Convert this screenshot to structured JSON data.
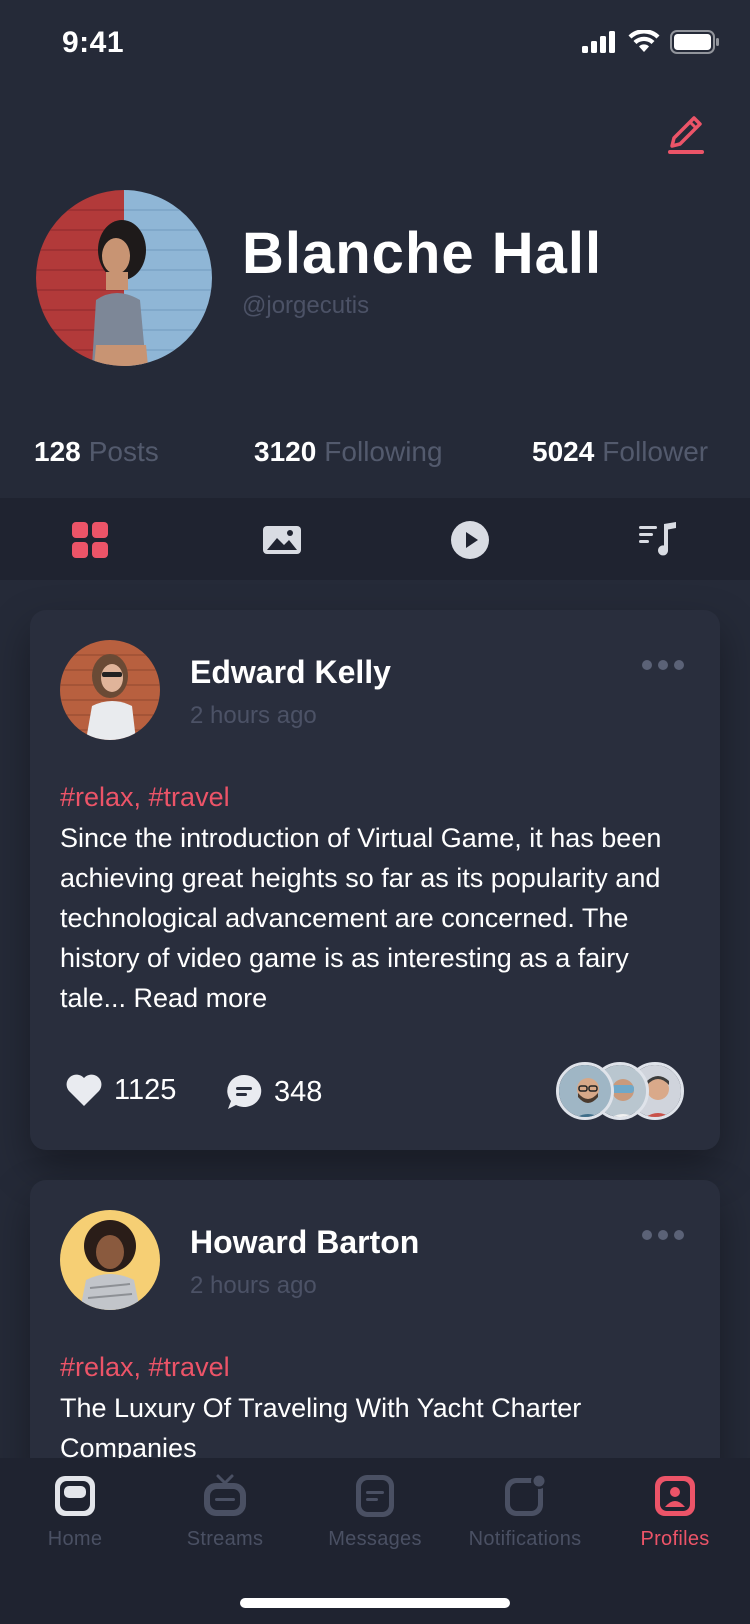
{
  "status": {
    "time": "9:41"
  },
  "profile": {
    "name": "Blanche Hall",
    "handle": "@jorgecutis",
    "stats": [
      {
        "count": "128",
        "label": "Posts"
      },
      {
        "count": "3120",
        "label": "Following"
      },
      {
        "count": "5024",
        "label": "Follower"
      }
    ]
  },
  "content_tabs": [
    {
      "icon": "grid-icon",
      "active": true
    },
    {
      "icon": "image-icon",
      "active": false
    },
    {
      "icon": "play-icon",
      "active": false
    },
    {
      "icon": "music-icon",
      "active": false
    }
  ],
  "posts": [
    {
      "author": "Edward Kelly",
      "time": "2 hours ago",
      "tags": "#relax, #travel",
      "body": "Since the introduction of Virtual Game, it has been achieving great heights so far as its popularity and technological advancement are concerned. The history of video game is as interesting as a fairy tale... Read more",
      "likes": "1125",
      "comments": "348"
    },
    {
      "author": "Howard Barton",
      "time": "2 hours ago",
      "tags": "#relax, #travel",
      "body": "The Luxury Of Traveling With Yacht Charter Companies"
    }
  ],
  "bottom_nav": [
    {
      "label": "Home",
      "icon": "home-icon",
      "active": false
    },
    {
      "label": "Streams",
      "icon": "tv-icon",
      "active": false
    },
    {
      "label": "Messages",
      "icon": "message-icon",
      "active": false
    },
    {
      "label": "Notifications",
      "icon": "notification-icon",
      "active": false
    },
    {
      "label": "Profiles",
      "icon": "profile-icon",
      "active": true
    }
  ],
  "colors": {
    "background": "#252a38",
    "card": "#292e3d",
    "accent": "#ec5468",
    "muted": "#4c5266"
  }
}
